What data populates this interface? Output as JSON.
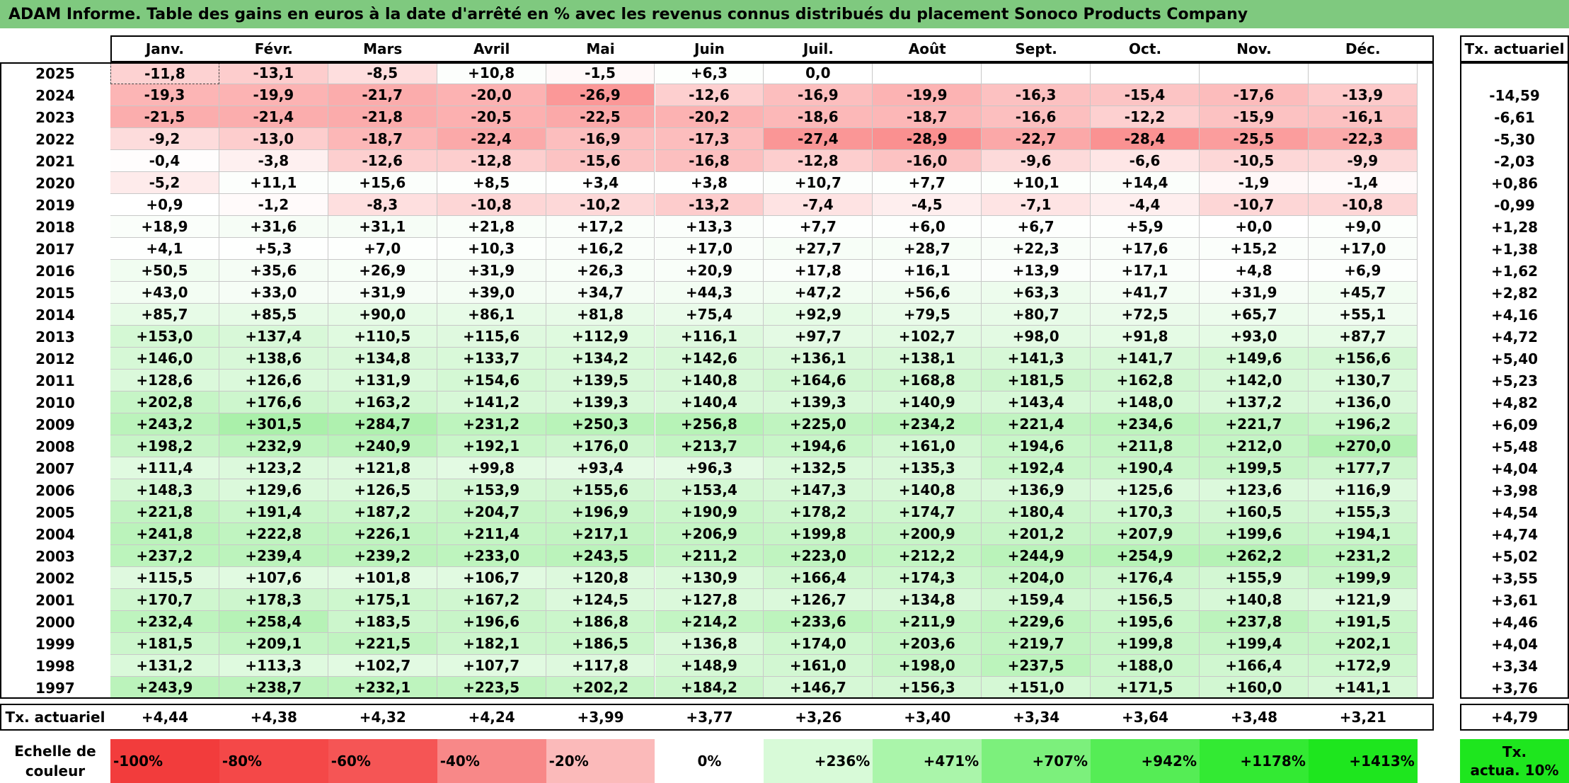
{
  "title": "ADAM Informe. Table des gains en euros à la date d'arrêté en % avec les revenus connus distribués du placement Sonoco Products Company",
  "chart_data": {
    "type": "table",
    "months": [
      "Janv.",
      "Févr.",
      "Mars",
      "Avril",
      "Mai",
      "Juin",
      "Juil.",
      "Août",
      "Sept.",
      "Oct.",
      "Nov.",
      "Déc."
    ],
    "rate_header": "Tx. actuariel",
    "rows": [
      {
        "year": "2025",
        "values": [
          "-11,8",
          "-13,1",
          "-8,5",
          "+10,8",
          "-1,5",
          "+6,3",
          "0,0",
          "",
          "",
          "",
          "",
          ""
        ],
        "rate": ""
      },
      {
        "year": "2024",
        "values": [
          "-19,3",
          "-19,9",
          "-21,7",
          "-20,0",
          "-26,9",
          "-12,6",
          "-16,9",
          "-19,9",
          "-16,3",
          "-15,4",
          "-17,6",
          "-13,9"
        ],
        "rate": "-14,59"
      },
      {
        "year": "2023",
        "values": [
          "-21,5",
          "-21,4",
          "-21,8",
          "-20,5",
          "-22,5",
          "-20,2",
          "-18,6",
          "-18,7",
          "-16,6",
          "-12,2",
          "-15,9",
          "-16,1"
        ],
        "rate": "-6,61"
      },
      {
        "year": "2022",
        "values": [
          "-9,2",
          "-13,0",
          "-18,7",
          "-22,4",
          "-16,9",
          "-17,3",
          "-27,4",
          "-28,9",
          "-22,7",
          "-28,4",
          "-25,5",
          "-22,3"
        ],
        "rate": "-5,30"
      },
      {
        "year": "2021",
        "values": [
          "-0,4",
          "-3,8",
          "-12,6",
          "-12,8",
          "-15,6",
          "-16,8",
          "-12,8",
          "-16,0",
          "-9,6",
          "-6,6",
          "-10,5",
          "-9,9"
        ],
        "rate": "-2,03"
      },
      {
        "year": "2020",
        "values": [
          "-5,2",
          "+11,1",
          "+15,6",
          "+8,5",
          "+3,4",
          "+3,8",
          "+10,7",
          "+7,7",
          "+10,1",
          "+14,4",
          "-1,9",
          "-1,4"
        ],
        "rate": "+0,86"
      },
      {
        "year": "2019",
        "values": [
          "+0,9",
          "-1,2",
          "-8,3",
          "-10,8",
          "-10,2",
          "-13,2",
          "-7,4",
          "-4,5",
          "-7,1",
          "-4,4",
          "-10,7",
          "-10,8"
        ],
        "rate": "-0,99"
      },
      {
        "year": "2018",
        "values": [
          "+18,9",
          "+31,6",
          "+31,1",
          "+21,8",
          "+17,2",
          "+13,3",
          "+7,7",
          "+6,0",
          "+6,7",
          "+5,9",
          "+0,0",
          "+9,0"
        ],
        "rate": "+1,28"
      },
      {
        "year": "2017",
        "values": [
          "+4,1",
          "+5,3",
          "+7,0",
          "+10,3",
          "+16,2",
          "+17,0",
          "+27,7",
          "+28,7",
          "+22,3",
          "+17,6",
          "+15,2",
          "+17,0"
        ],
        "rate": "+1,38"
      },
      {
        "year": "2016",
        "values": [
          "+50,5",
          "+35,6",
          "+26,9",
          "+31,9",
          "+26,3",
          "+20,9",
          "+17,8",
          "+16,1",
          "+13,9",
          "+17,1",
          "+4,8",
          "+6,9"
        ],
        "rate": "+1,62"
      },
      {
        "year": "2015",
        "values": [
          "+43,0",
          "+33,0",
          "+31,9",
          "+39,0",
          "+34,7",
          "+44,3",
          "+47,2",
          "+56,6",
          "+63,3",
          "+41,7",
          "+31,9",
          "+45,7"
        ],
        "rate": "+2,82"
      },
      {
        "year": "2014",
        "values": [
          "+85,7",
          "+85,5",
          "+90,0",
          "+86,1",
          "+81,8",
          "+75,4",
          "+92,9",
          "+79,5",
          "+80,7",
          "+72,5",
          "+65,7",
          "+55,1"
        ],
        "rate": "+4,16"
      },
      {
        "year": "2013",
        "values": [
          "+153,0",
          "+137,4",
          "+110,5",
          "+115,6",
          "+112,9",
          "+116,1",
          "+97,7",
          "+102,7",
          "+98,0",
          "+91,8",
          "+93,0",
          "+87,7"
        ],
        "rate": "+4,72"
      },
      {
        "year": "2012",
        "values": [
          "+146,0",
          "+138,6",
          "+134,8",
          "+133,7",
          "+134,2",
          "+142,6",
          "+136,1",
          "+138,1",
          "+141,3",
          "+141,7",
          "+149,6",
          "+156,6"
        ],
        "rate": "+5,40"
      },
      {
        "year": "2011",
        "values": [
          "+128,6",
          "+126,6",
          "+131,9",
          "+154,6",
          "+139,5",
          "+140,8",
          "+164,6",
          "+168,8",
          "+181,5",
          "+162,8",
          "+142,0",
          "+130,7"
        ],
        "rate": "+5,23"
      },
      {
        "year": "2010",
        "values": [
          "+202,8",
          "+176,6",
          "+163,2",
          "+141,2",
          "+139,3",
          "+140,4",
          "+139,3",
          "+140,9",
          "+143,4",
          "+148,0",
          "+137,2",
          "+136,0"
        ],
        "rate": "+4,82"
      },
      {
        "year": "2009",
        "values": [
          "+243,2",
          "+301,5",
          "+284,7",
          "+231,2",
          "+250,3",
          "+256,8",
          "+225,0",
          "+234,2",
          "+221,4",
          "+234,6",
          "+221,7",
          "+196,2"
        ],
        "rate": "+6,09"
      },
      {
        "year": "2008",
        "values": [
          "+198,2",
          "+232,9",
          "+240,9",
          "+192,1",
          "+176,0",
          "+213,7",
          "+194,6",
          "+161,0",
          "+194,6",
          "+211,8",
          "+212,0",
          "+270,0"
        ],
        "rate": "+5,48"
      },
      {
        "year": "2007",
        "values": [
          "+111,4",
          "+123,2",
          "+121,8",
          "+99,8",
          "+93,4",
          "+96,3",
          "+132,5",
          "+135,3",
          "+192,4",
          "+190,4",
          "+199,5",
          "+177,7"
        ],
        "rate": "+4,04"
      },
      {
        "year": "2006",
        "values": [
          "+148,3",
          "+129,6",
          "+126,5",
          "+153,9",
          "+155,6",
          "+153,4",
          "+147,3",
          "+140,8",
          "+136,9",
          "+125,6",
          "+123,6",
          "+116,9"
        ],
        "rate": "+3,98"
      },
      {
        "year": "2005",
        "values": [
          "+221,8",
          "+191,4",
          "+187,2",
          "+204,7",
          "+196,9",
          "+190,9",
          "+178,2",
          "+174,7",
          "+180,4",
          "+170,3",
          "+160,5",
          "+155,3"
        ],
        "rate": "+4,54"
      },
      {
        "year": "2004",
        "values": [
          "+241,8",
          "+222,8",
          "+226,1",
          "+211,4",
          "+217,1",
          "+206,9",
          "+199,8",
          "+200,9",
          "+201,2",
          "+207,9",
          "+199,6",
          "+194,1"
        ],
        "rate": "+4,74"
      },
      {
        "year": "2003",
        "values": [
          "+237,2",
          "+239,4",
          "+239,2",
          "+233,0",
          "+243,5",
          "+211,2",
          "+223,0",
          "+212,2",
          "+244,9",
          "+254,9",
          "+262,2",
          "+231,2"
        ],
        "rate": "+5,02"
      },
      {
        "year": "2002",
        "values": [
          "+115,5",
          "+107,6",
          "+101,8",
          "+106,7",
          "+120,8",
          "+130,9",
          "+166,4",
          "+174,3",
          "+204,0",
          "+176,4",
          "+155,9",
          "+199,9"
        ],
        "rate": "+3,55"
      },
      {
        "year": "2001",
        "values": [
          "+170,7",
          "+178,3",
          "+175,1",
          "+167,2",
          "+124,5",
          "+127,8",
          "+126,7",
          "+134,8",
          "+159,4",
          "+156,5",
          "+140,8",
          "+121,9"
        ],
        "rate": "+3,61"
      },
      {
        "year": "2000",
        "values": [
          "+232,4",
          "+258,4",
          "+183,5",
          "+196,6",
          "+186,8",
          "+214,2",
          "+233,6",
          "+211,9",
          "+229,6",
          "+195,6",
          "+237,8",
          "+191,5"
        ],
        "rate": "+4,46"
      },
      {
        "year": "1999",
        "values": [
          "+181,5",
          "+209,1",
          "+221,5",
          "+182,1",
          "+186,5",
          "+136,8",
          "+174,0",
          "+203,6",
          "+219,7",
          "+199,8",
          "+199,4",
          "+202,1"
        ],
        "rate": "+4,04"
      },
      {
        "year": "1998",
        "values": [
          "+131,2",
          "+113,3",
          "+102,7",
          "+107,7",
          "+117,8",
          "+148,9",
          "+161,0",
          "+198,0",
          "+237,5",
          "+188,0",
          "+166,4",
          "+172,9"
        ],
        "rate": "+3,34"
      },
      {
        "year": "1997",
        "values": [
          "+243,9",
          "+238,7",
          "+232,1",
          "+223,5",
          "+202,2",
          "+184,2",
          "+146,7",
          "+156,3",
          "+151,0",
          "+171,5",
          "+160,0",
          "+141,1"
        ],
        "rate": "+3,76"
      }
    ],
    "footer": {
      "label": "Tx. actuariel",
      "values": [
        "+4,44",
        "+4,38",
        "+4,32",
        "+4,24",
        "+3,99",
        "+3,77",
        "+3,26",
        "+3,40",
        "+3,34",
        "+3,64",
        "+3,48",
        "+3,21"
      ],
      "rate": "+4,79"
    },
    "scale": {
      "label_line1": "Echelle de",
      "label_line2": "couleur",
      "steps": [
        {
          "label": "-100%",
          "color": "#f23c3c"
        },
        {
          "label": "-80%",
          "color": "#f44848"
        },
        {
          "label": "-60%",
          "color": "#f55555"
        },
        {
          "label": "-40%",
          "color": "#f88888"
        },
        {
          "label": "-20%",
          "color": "#fbbaba"
        },
        {
          "label": "0%",
          "color": "#ffffff"
        },
        {
          "label": "+236%",
          "color": "#d8fad8"
        },
        {
          "label": "+471%",
          "color": "#aaf5aa"
        },
        {
          "label": "+707%",
          "color": "#7cf07c"
        },
        {
          "label": "+942%",
          "color": "#55ed55"
        },
        {
          "label": "+1178%",
          "color": "#33ea33"
        },
        {
          "label": "+1413%",
          "color": "#1ee61e"
        }
      ],
      "rate_line1": "Tx.",
      "rate_line2": "actua. 10%",
      "rate_color": "#1ee61e"
    },
    "colors": {
      "title_bg": "#7fc97f",
      "negative_max": "#fa8c8c",
      "positive_max": "#a8f0a8"
    }
  }
}
